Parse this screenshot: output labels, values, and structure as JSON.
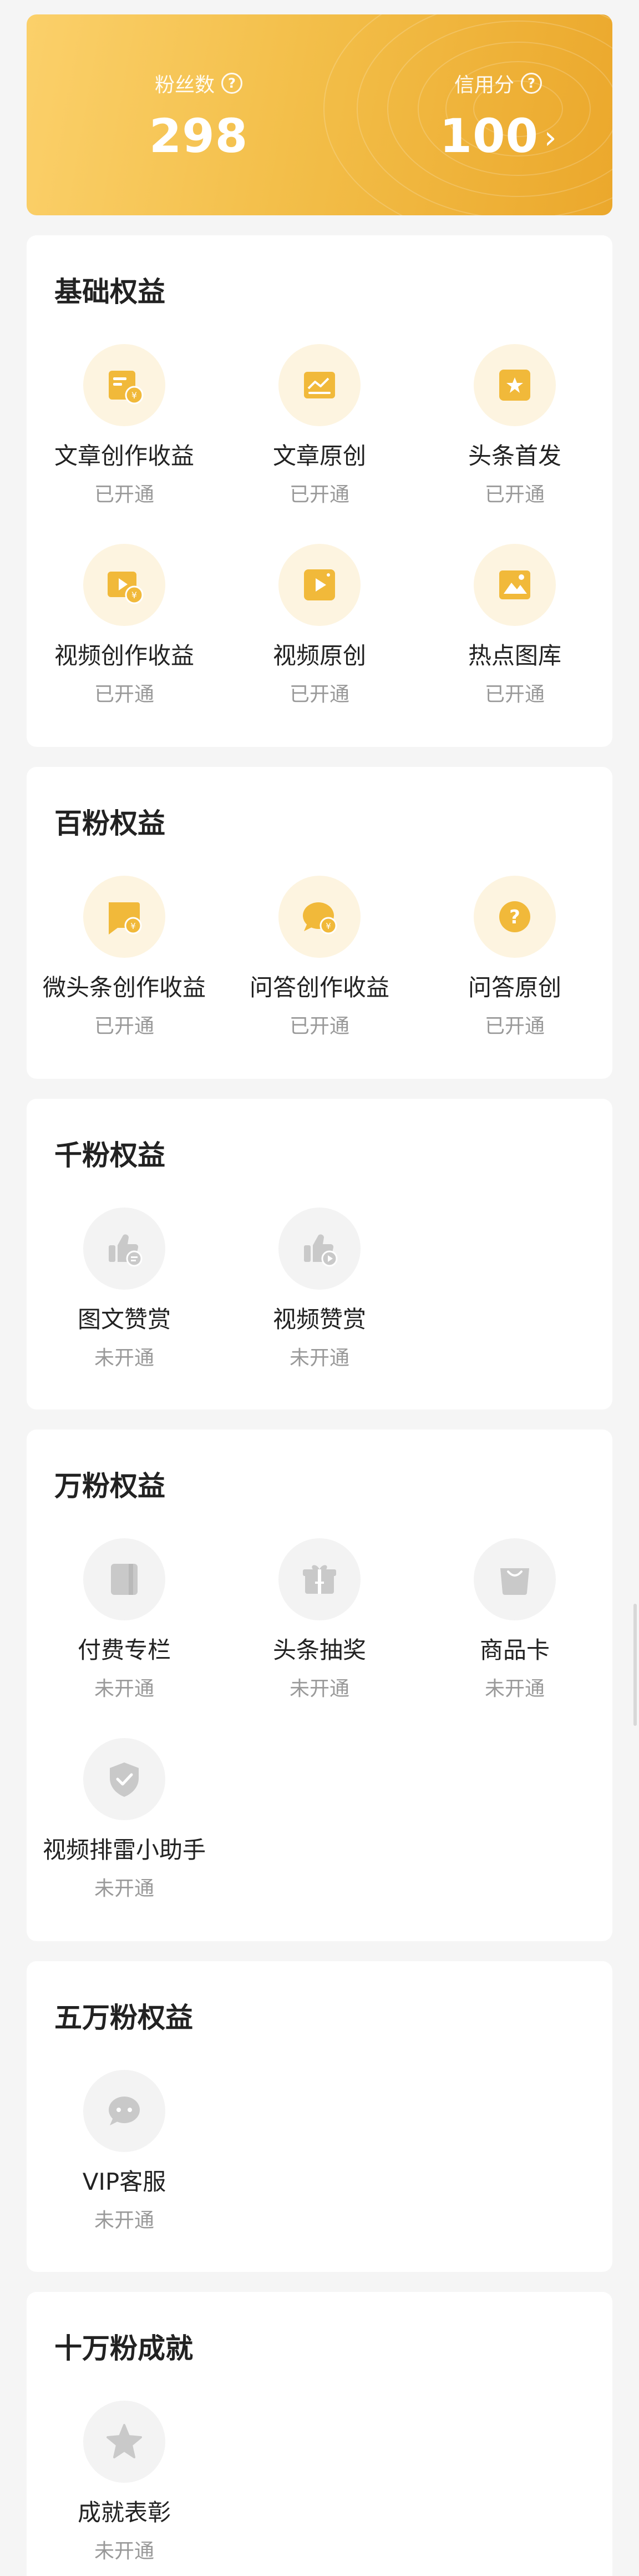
{
  "stats": {
    "fans_label": "粉丝数",
    "fans_value": "298",
    "credit_label": "信用分",
    "credit_value": "100",
    "help_glyph": "?",
    "chevron_glyph": "›"
  },
  "colors": {
    "accent_gold": "#f3bf4a",
    "icon_gold": "#f1b93a",
    "icon_gray": "#c9c9c9"
  },
  "sections": [
    {
      "title": "基础权益",
      "items": [
        {
          "label": "文章创作收益",
          "status": "已开通",
          "icon": "article-income-icon"
        },
        {
          "label": "文章原创",
          "status": "已开通",
          "icon": "article-original-icon"
        },
        {
          "label": "头条首发",
          "status": "已开通",
          "icon": "headline-first-icon"
        },
        {
          "label": "视频创作收益",
          "status": "已开通",
          "icon": "video-income-icon"
        },
        {
          "label": "视频原创",
          "status": "已开通",
          "icon": "video-original-icon"
        },
        {
          "label": "热点图库",
          "status": "已开通",
          "icon": "image-library-icon"
        }
      ]
    },
    {
      "title": "百粉权益",
      "items": [
        {
          "label": "微头条创作收益",
          "status": "已开通",
          "icon": "micro-headline-income-icon"
        },
        {
          "label": "问答创作收益",
          "status": "已开通",
          "icon": "qa-income-icon"
        },
        {
          "label": "问答原创",
          "status": "已开通",
          "icon": "qa-original-icon"
        }
      ]
    },
    {
      "title": "千粉权益",
      "items": [
        {
          "label": "图文赞赏",
          "status": "未开通",
          "icon": "article-tip-icon"
        },
        {
          "label": "视频赞赏",
          "status": "未开通",
          "icon": "video-tip-icon"
        }
      ]
    },
    {
      "title": "万粉权益",
      "items": [
        {
          "label": "付费专栏",
          "status": "未开通",
          "icon": "paid-column-icon"
        },
        {
          "label": "头条抽奖",
          "status": "未开通",
          "icon": "lottery-gift-icon"
        },
        {
          "label": "商品卡",
          "status": "未开通",
          "icon": "product-card-icon"
        },
        {
          "label": "视频排雷小助手",
          "status": "未开通",
          "icon": "video-shield-icon"
        }
      ]
    },
    {
      "title": "五万粉权益",
      "items": [
        {
          "label": "VIP客服",
          "status": "未开通",
          "icon": "vip-service-icon"
        }
      ]
    },
    {
      "title": "十万粉成就",
      "items": [
        {
          "label": "成就表彰",
          "status": "未开通",
          "icon": "achievement-star-icon"
        }
      ]
    }
  ]
}
